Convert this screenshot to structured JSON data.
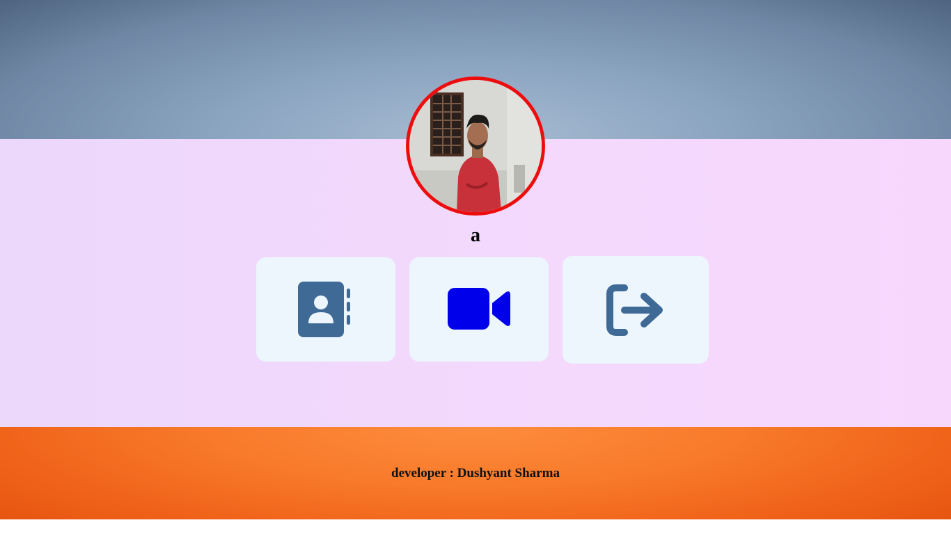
{
  "profile": {
    "name": "a",
    "avatar_icon": "user-photo"
  },
  "actions": [
    {
      "name": "contacts",
      "icon": "address-book-icon",
      "color": "#3f6a96"
    },
    {
      "name": "video-call",
      "icon": "video-camera-icon",
      "color": "#0000ea"
    },
    {
      "name": "logout",
      "icon": "sign-out-icon",
      "color": "#3f6a96"
    }
  ],
  "footer": {
    "developer_text": "developer : Dushyant Sharma"
  },
  "colors": {
    "avatar_border": "#ee0d0d",
    "tile_background": "#edf5fd",
    "footer_orange": "#f87a2a",
    "main_background": "#f4d9fd"
  }
}
